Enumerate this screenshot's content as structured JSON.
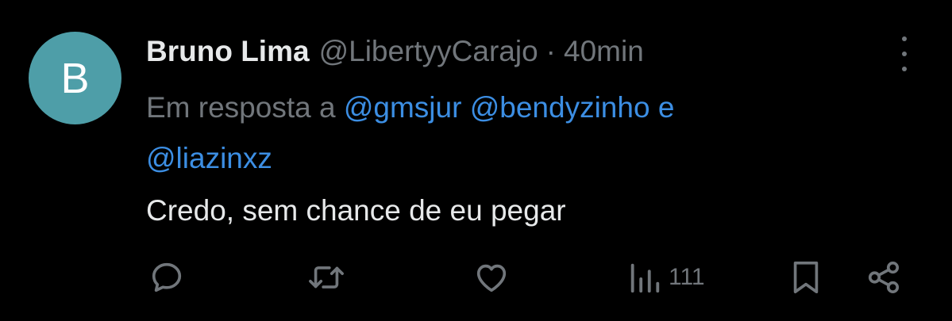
{
  "author": {
    "avatar_letter": "B",
    "avatar_color": "#4e9ea8",
    "name": "Bruno Lima",
    "handle": "@LibertyyCarajo",
    "separator": "·",
    "time": "40min"
  },
  "reply": {
    "prefix": "Em resposta a",
    "mention1": "@gmsjur",
    "mention2": "@bendyzinho",
    "conjunction": "e",
    "mention3": "@liazinxz"
  },
  "content": {
    "text": "Credo, sem chance de eu pegar"
  },
  "actions": {
    "views_count": "111",
    "icons": [
      "reply-icon",
      "retweet-icon",
      "like-icon",
      "views-icon",
      "bookmark-icon",
      "share-icon"
    ]
  },
  "colors": {
    "background": "#000000",
    "primary_text": "#e7e9ea",
    "secondary_text": "#71767b",
    "link": "#3c8ee3"
  }
}
